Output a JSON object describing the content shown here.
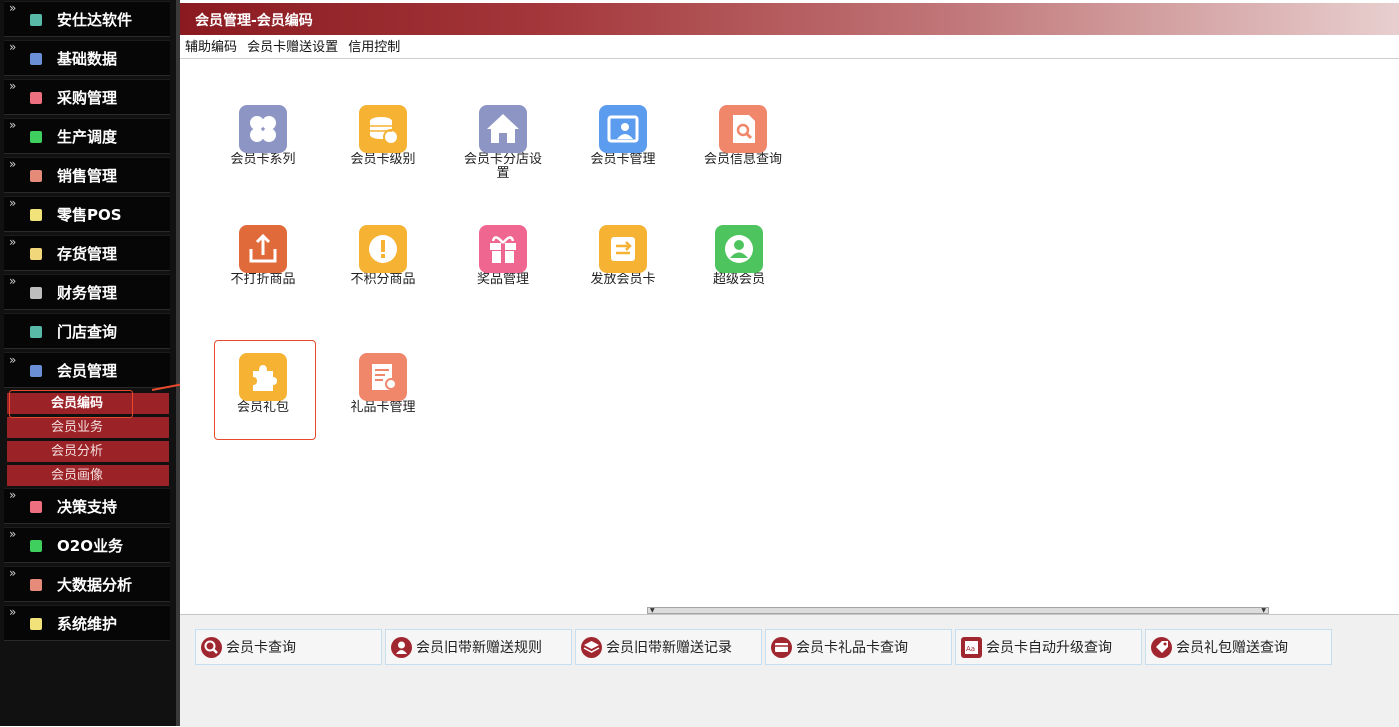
{
  "sidebar": {
    "items": [
      {
        "label": "安仕达软件",
        "color": "#58b9a8"
      },
      {
        "label": "基础数据",
        "color": "#6a8fd6"
      },
      {
        "label": "采购管理",
        "color": "#ee6f7f"
      },
      {
        "label": "生产调度",
        "color": "#3fcf5f"
      },
      {
        "label": "销售管理",
        "color": "#e68a7a"
      },
      {
        "label": "零售POS",
        "color": "#f1e37a"
      },
      {
        "label": "存货管理",
        "color": "#f1d67a"
      },
      {
        "label": "财务管理",
        "color": "#bdbdbd"
      },
      {
        "label": "门店查询",
        "color": "#58b9a8"
      },
      {
        "label": "会员管理",
        "color": "#6a8fd6"
      },
      {
        "label": "决策支持",
        "color": "#ee6f7f"
      },
      {
        "label": "O2O业务",
        "color": "#3fcf5f"
      },
      {
        "label": "大数据分析",
        "color": "#e68a7a"
      },
      {
        "label": "系统维护",
        "color": "#f1e37a"
      }
    ],
    "subitems": [
      {
        "label": "会员编码"
      },
      {
        "label": "会员业务"
      },
      {
        "label": "会员分析"
      },
      {
        "label": "会员画像"
      }
    ]
  },
  "header": {
    "title": "会员管理-会员编码"
  },
  "toolbar": {
    "links": [
      {
        "label": "辅助编码"
      },
      {
        "label": "会员卡赠送设置"
      },
      {
        "label": "信用控制"
      }
    ]
  },
  "tiles": [
    {
      "label": "会员卡系列",
      "color": "#8c95c3",
      "icon": "clover-icon"
    },
    {
      "label": "会员卡级别",
      "color": "#f5b233",
      "icon": "coins-icon"
    },
    {
      "label": "会员卡分店设置",
      "color": "#8c95c3",
      "icon": "house-icon"
    },
    {
      "label": "会员卡管理",
      "color": "#5b9cef",
      "icon": "id-card-icon"
    },
    {
      "label": "会员信息查询",
      "color": "#f0866a",
      "icon": "document-search-icon"
    },
    {
      "label": "不打折商品",
      "color": "#e06a3a",
      "icon": "export-icon"
    },
    {
      "label": "不积分商品",
      "color": "#f5b233",
      "icon": "warning-icon"
    },
    {
      "label": "奖品管理",
      "color": "#ef6690",
      "icon": "gift-icon"
    },
    {
      "label": "发放会员卡",
      "color": "#f5b233",
      "icon": "swap-icon"
    },
    {
      "label": "超级会员",
      "color": "#4ec45f",
      "icon": "user-icon"
    },
    {
      "label": "会员礼包",
      "color": "#f5b233",
      "icon": "puzzle-icon"
    },
    {
      "label": "礼品卡管理",
      "color": "#f0866a",
      "icon": "card-document-icon"
    }
  ],
  "quick": [
    {
      "label": "会员卡查询",
      "icon": "search-icon"
    },
    {
      "label": "会员旧带新赠送规则",
      "icon": "person-icon"
    },
    {
      "label": "会员旧带新赠送记录",
      "icon": "layers-icon"
    },
    {
      "label": "会员卡礼品卡查询",
      "icon": "card-icon"
    },
    {
      "label": "会员卡自动升级查询",
      "icon": "aa-icon"
    },
    {
      "label": "会员礼包赠送查询",
      "icon": "tag-icon"
    }
  ]
}
